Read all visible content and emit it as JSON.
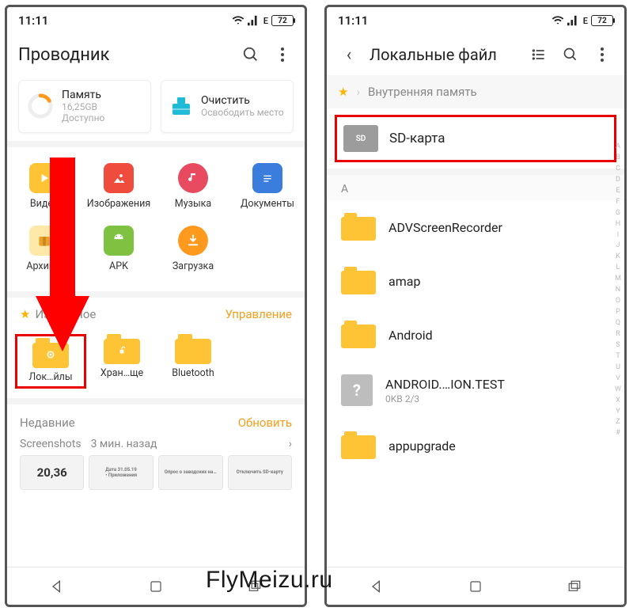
{
  "status": {
    "time": "11:11",
    "battery": "72",
    "signal_label": "E"
  },
  "left": {
    "title": "Проводник",
    "memory": {
      "label": "Память",
      "size": "16,25GB",
      "avail": "Доступно"
    },
    "clean": {
      "label": "Очистить",
      "sub": "Освободить место"
    },
    "categories": {
      "row1": [
        "Видео",
        "Изображения",
        "Музыка",
        "Документы"
      ],
      "row2": [
        "Архивы",
        "APK",
        "Загрузка"
      ]
    },
    "fav": {
      "label": "Избранное",
      "mgmt": "Управление"
    },
    "folders": [
      "Лок…йлы",
      "Хран…ще",
      "Bluetooth"
    ],
    "recent": {
      "label": "Недавние",
      "update": "Обновить"
    },
    "screenshots": {
      "label": "Screenshots",
      "ago": "3 мин. назад"
    },
    "thumb1": "20,36"
  },
  "right": {
    "title": "Локальные файл",
    "crumb": "Внутренняя память",
    "sd": "SD-карта",
    "section": "A",
    "files": [
      {
        "name": "ADVScreenRecorder",
        "type": "folder"
      },
      {
        "name": "amap",
        "type": "folder"
      },
      {
        "name": "Android",
        "type": "folder"
      },
      {
        "name": "ANDROID.…ION.TEST",
        "type": "file",
        "sub": "0KB  2/3"
      },
      {
        "name": "appupgrade",
        "type": "folder"
      }
    ],
    "index": [
      "A",
      "B",
      "C",
      "D",
      "E",
      "F",
      "G",
      "H",
      "I",
      "J",
      "K",
      "L",
      "M",
      "N",
      "O",
      "P",
      "Q",
      "R",
      "S",
      "T",
      "U",
      "V",
      "W",
      "X",
      "Y",
      "Z",
      "#"
    ]
  },
  "watermark": "FlyMeizu.ru"
}
